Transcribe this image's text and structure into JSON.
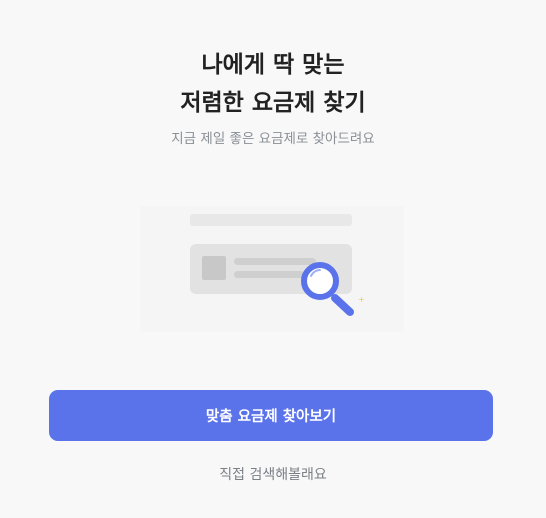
{
  "headline": {
    "line1": "나에게 딱 맞는",
    "line2": "저렴한 요금제 찾기"
  },
  "subtitle": "지금 제일 좋은 요금제로 찾아드려요",
  "illustration": {
    "icon": "magnifier-search-icon",
    "accent_color": "#5a72ea"
  },
  "actions": {
    "primary_label": "맞춤 요금제 찾아보기",
    "secondary_label": "직접 검색해볼래요"
  },
  "colors": {
    "primary": "#5a72ea",
    "background": "#f8f8f8"
  }
}
